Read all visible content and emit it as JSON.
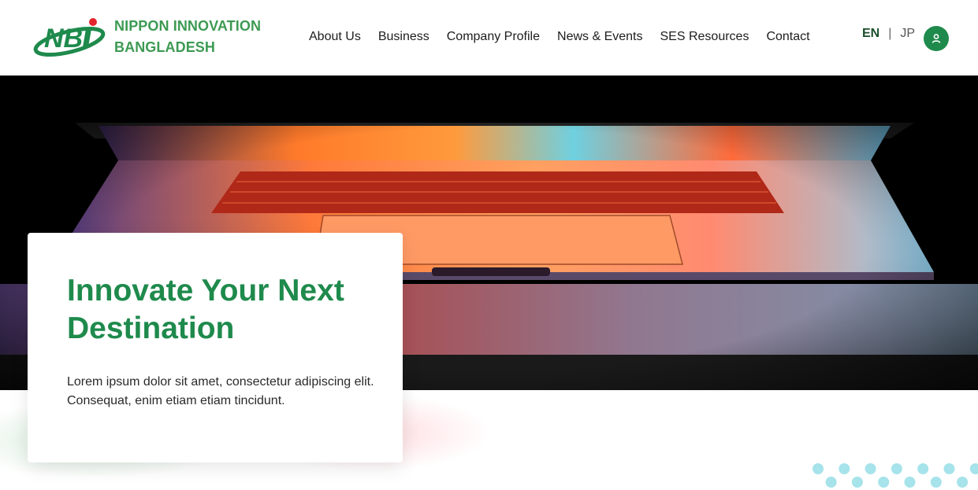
{
  "header": {
    "brand_line1": "NIPPON INNOVATION",
    "brand_line2": "BANGLADESH",
    "logo_letters": "NBi",
    "nav": [
      {
        "label": "About Us"
      },
      {
        "label": "Business"
      },
      {
        "label": "Company Profile"
      },
      {
        "label": "News & Events"
      },
      {
        "label": "SES Resources"
      },
      {
        "label": "Contact"
      }
    ],
    "lang_en": "EN",
    "lang_sep": "|",
    "lang_jp": "JP",
    "user_icon": "user-icon"
  },
  "hero": {
    "title": "Innovate Your Next Destination",
    "text": "Lorem ipsum dolor sit amet, consectetur adipiscing elit. Consequat, enim etiam etiam tincidunt.",
    "image": "laptop-photo"
  },
  "colors": {
    "brand_green": "#1e8a4c",
    "brand_text_green": "#3d9a53",
    "dots_cyan": "#a6e3ea"
  }
}
